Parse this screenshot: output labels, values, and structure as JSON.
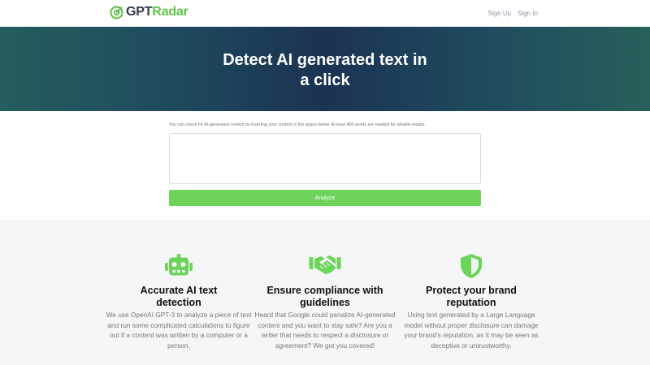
{
  "nav": {
    "logo_gpt": "GPT",
    "logo_radar": "Radar",
    "sign_up": "Sign Up",
    "sign_in": "Sign In",
    "logo_icon": "radar-icon"
  },
  "hero": {
    "title_line1": "Detect AI generated text in",
    "title_line2": "a click"
  },
  "form": {
    "hint": "You can check for AI-generated content by inserting your content in the space below. At least 400 words are needed for reliable results.",
    "textarea_value": "",
    "analyze_label": "Analyze"
  },
  "features": [
    {
      "icon": "robot-icon",
      "title_line1": "Accurate AI text",
      "title_line2": "detection",
      "desc": "We use OpenAI GPT-3 to analyze a piece of text and run some complicated calculations to figure out if a content was written by a computer or a person."
    },
    {
      "icon": "handshake-icon",
      "title_line1": "Ensure compliance with",
      "title_line2": "guidelines",
      "desc": "Heard that Google could penalize AI-generated content and you want to stay safe? Are you a writer that needs to respect a disclosure or agreement? We got you covered!"
    },
    {
      "icon": "shield-icon",
      "title_line1": "Protect your brand",
      "title_line2": "reputation",
      "desc": "Using text generated by a Large Language model without proper disclosure can damage your brand's reputation, as it may be seen as deceptive or untrustworthy."
    }
  ],
  "colors": {
    "accent": "#6ed35b",
    "logo_dark": "#2e3a4b",
    "hero_dark": "#1b3352"
  }
}
